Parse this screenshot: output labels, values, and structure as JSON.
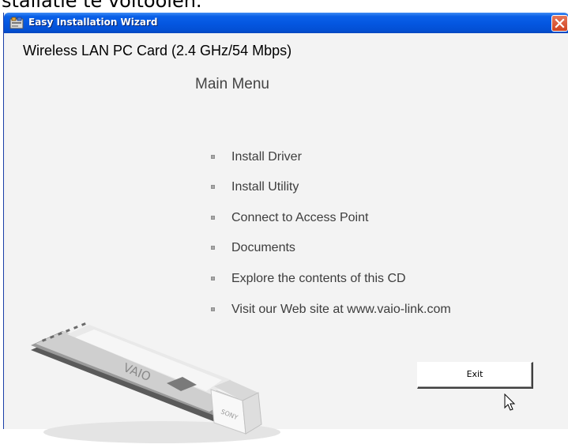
{
  "top_text": "stallatie te voltooien.",
  "window": {
    "title": "Easy Installation Wizard"
  },
  "content": {
    "product_title": "Wireless LAN PC Card (2.4 GHz/54 Mbps)",
    "menu_title": "Main Menu",
    "menu_items": [
      {
        "label": "Install Driver"
      },
      {
        "label": "Install Utility"
      },
      {
        "label": "Connect to Access Point"
      },
      {
        "label": "Documents"
      },
      {
        "label": "Explore the contents of this CD"
      },
      {
        "label": "Visit our Web site at www.vaio-link.com"
      }
    ],
    "exit_label": "Exit",
    "card_branding": "VAIO",
    "card_brand_side": "SONY"
  },
  "icons": {
    "app": "installer-app-icon",
    "close": "close-icon",
    "bullet": "square-bullet-icon",
    "cursor": "mouse-pointer-icon"
  },
  "colors": {
    "titlebar": "#0456e0",
    "close_button": "#d8502c",
    "background": "#f3f3f3"
  }
}
